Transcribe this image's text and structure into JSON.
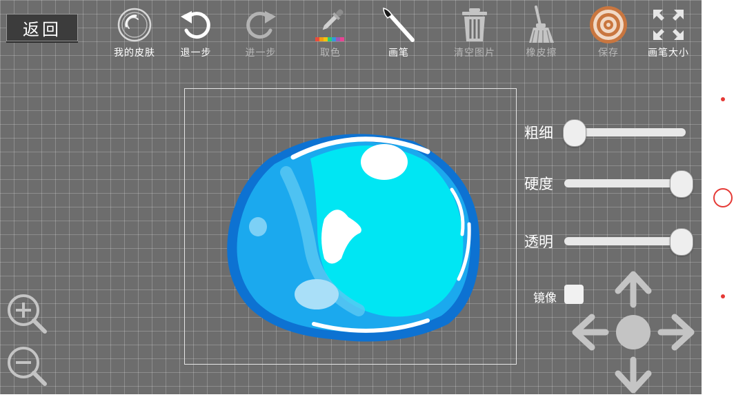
{
  "back_label": "返回",
  "toolbar": {
    "skin": "我的皮肤",
    "undo": "退一步",
    "redo": "进一步",
    "pick_color": "取色",
    "brush": "画笔",
    "clear": "清空图片",
    "eraser": "橡皮擦",
    "save": "保存",
    "brush_size": "画笔大小"
  },
  "sliders": [
    {
      "label": "粗细",
      "value": 0.08
    },
    {
      "label": "硬度",
      "value": 0.96
    },
    {
      "label": "透明",
      "value": 0.96
    }
  ],
  "mirror": {
    "label": "镜像",
    "checked": false
  },
  "icons": {
    "zoom_in": "zoom-in-icon",
    "zoom_out": "zoom-out-icon",
    "dpad": "direction-pad-icon"
  },
  "colors": {
    "accent_red": "#e53935",
    "canvas_bg": "#6d6d6d",
    "slime_light": "#00e9f4",
    "slime_mid": "#1fb0ee",
    "slime_dark": "#0f77d5"
  }
}
